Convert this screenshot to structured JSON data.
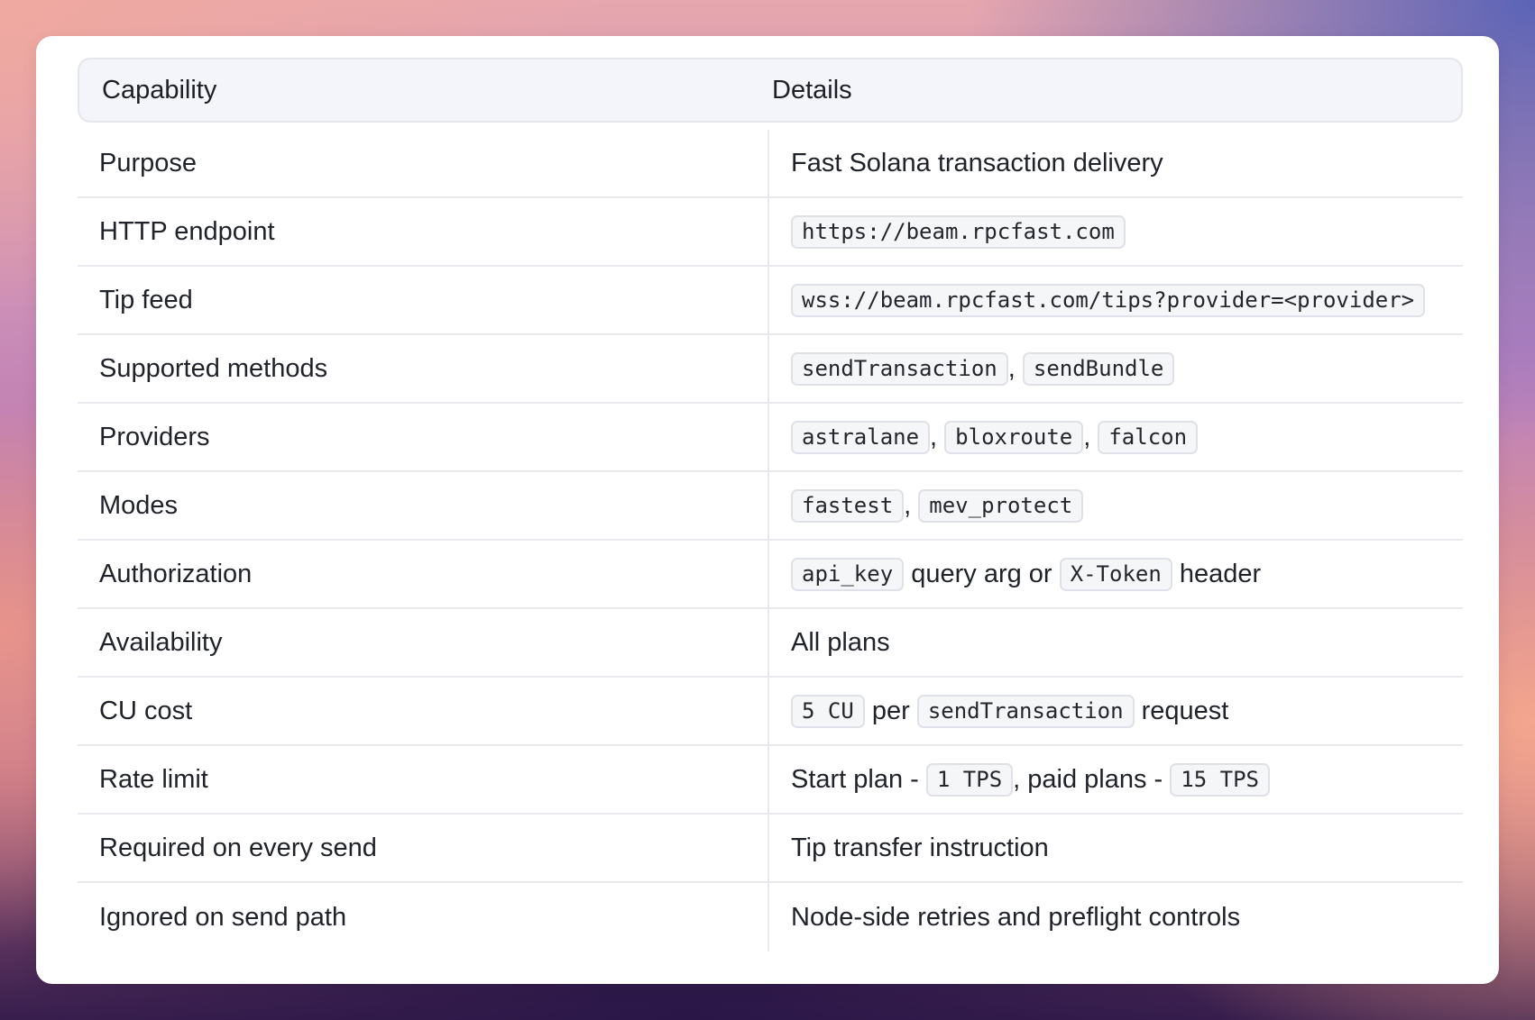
{
  "table": {
    "headers": {
      "capability": "Capability",
      "details": "Details"
    },
    "rows": [
      {
        "label": "Purpose",
        "details": [
          {
            "t": "Fast Solana transaction delivery"
          }
        ]
      },
      {
        "label": "HTTP endpoint",
        "details": [
          {
            "c": "https://beam.rpcfast.com"
          }
        ]
      },
      {
        "label": "Tip feed",
        "details": [
          {
            "c": "wss://beam.rpcfast.com/tips?provider=<provider>"
          }
        ]
      },
      {
        "label": "Supported methods",
        "details": [
          {
            "c": "sendTransaction"
          },
          {
            "t": ", "
          },
          {
            "c": "sendBundle"
          }
        ]
      },
      {
        "label": "Providers",
        "details": [
          {
            "c": "astralane"
          },
          {
            "t": ", "
          },
          {
            "c": "bloxroute"
          },
          {
            "t": ", "
          },
          {
            "c": "falcon"
          }
        ]
      },
      {
        "label": "Modes",
        "details": [
          {
            "c": "fastest"
          },
          {
            "t": ", "
          },
          {
            "c": "mev_protect"
          }
        ]
      },
      {
        "label": "Authorization",
        "details": [
          {
            "c": "api_key"
          },
          {
            "t": " query arg or "
          },
          {
            "c": "X-Token"
          },
          {
            "t": " header"
          }
        ]
      },
      {
        "label": "Availability",
        "details": [
          {
            "t": "All plans"
          }
        ]
      },
      {
        "label": "CU cost",
        "details": [
          {
            "c": "5 CU"
          },
          {
            "t": " per "
          },
          {
            "c": "sendTransaction"
          },
          {
            "t": " request"
          }
        ]
      },
      {
        "label": "Rate limit",
        "details": [
          {
            "t": "Start plan - "
          },
          {
            "c": "1 TPS"
          },
          {
            "t": ", paid plans - "
          },
          {
            "c": "15 TPS"
          }
        ]
      },
      {
        "label": "Required on every send",
        "details": [
          {
            "t": "Tip transfer instruction"
          }
        ]
      },
      {
        "label": "Ignored on send path",
        "details": [
          {
            "t": "Node-side retries and preflight controls"
          }
        ]
      }
    ]
  }
}
